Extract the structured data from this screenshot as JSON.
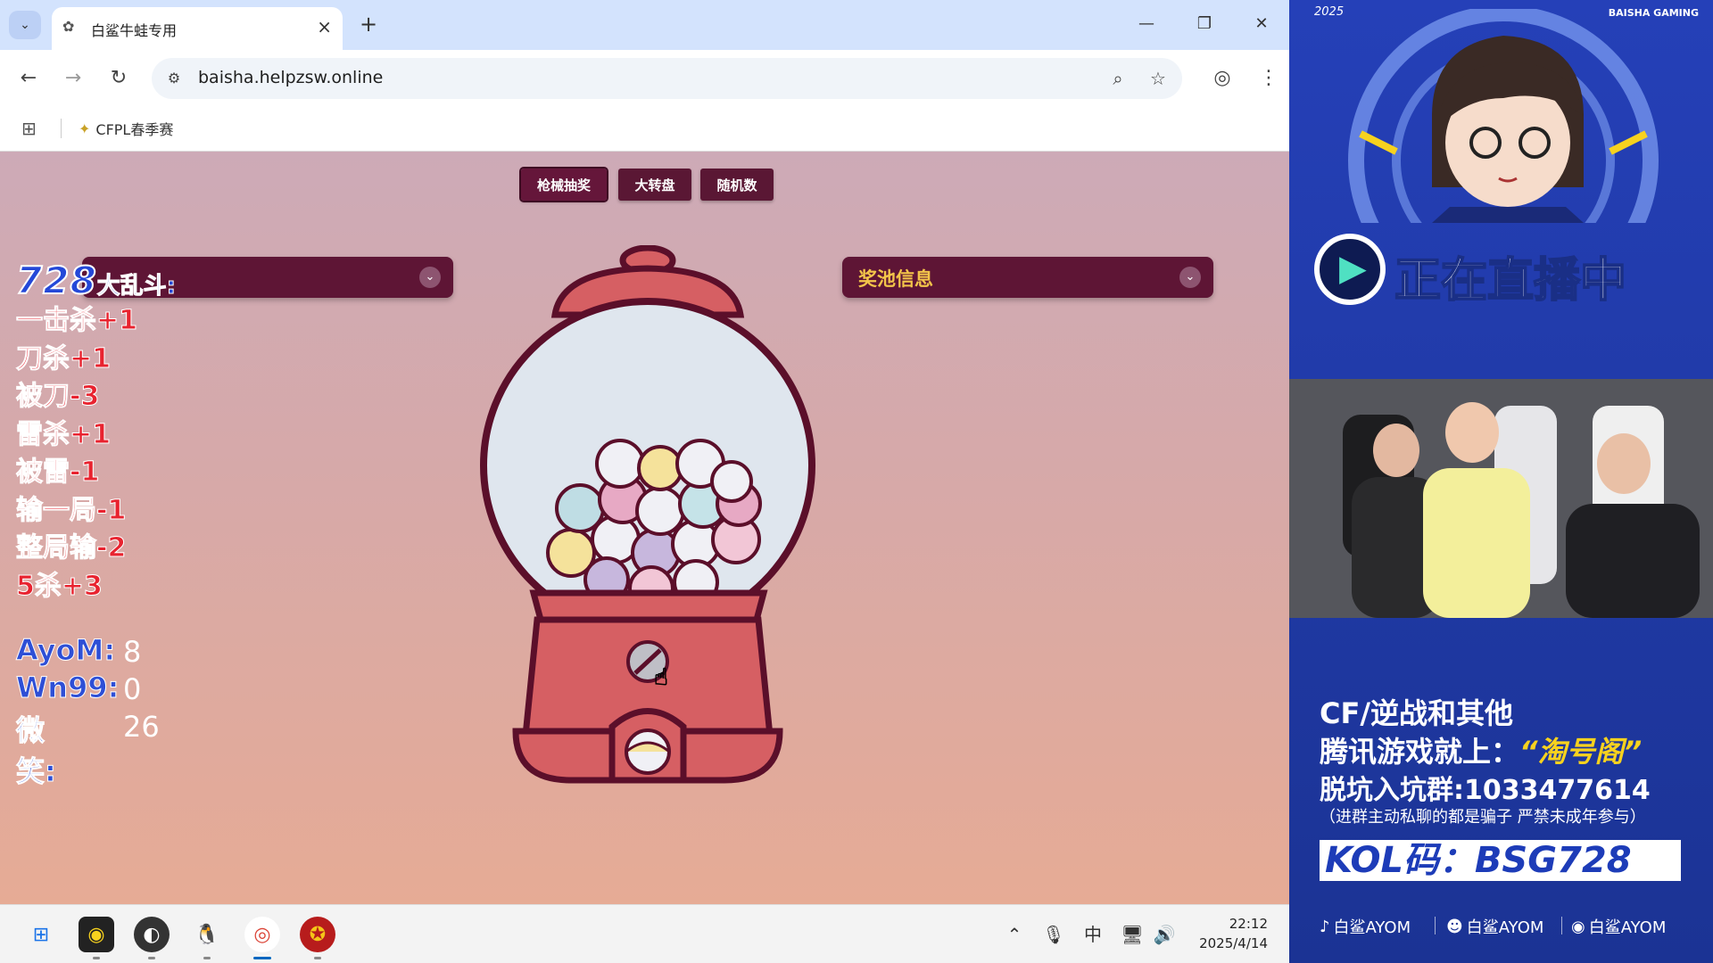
{
  "browser": {
    "tab_title": "白鲨牛蛙专用",
    "url": "baisha.helpzsw.online",
    "bookmark": "CFPL春季赛"
  },
  "page": {
    "buttons": [
      "枪械抽奖",
      "大转盘",
      "随机数"
    ],
    "active_button": "枪械抽奖",
    "right_panel_title": "奖池信息"
  },
  "overlay": {
    "title": "728",
    "subtitle": "大乱斗:",
    "rules": [
      "一击杀+1",
      "刀杀+1",
      "被刀-3",
      "雷杀+1",
      "被雷-1",
      "输一局-1",
      "整局输-2",
      "5杀+3"
    ],
    "scores": [
      {
        "name": "AyoM:",
        "value": "8"
      },
      {
        "name": "Wn99:",
        "value": "0"
      },
      {
        "name": "微笑:",
        "value": "26"
      }
    ]
  },
  "taskbar": {
    "ime": "中",
    "time": "22:12",
    "date": "2025/4/14"
  },
  "stream": {
    "year": "2025",
    "brand": "BAISHA GAMING",
    "live_text": "正在直播中",
    "ad_line1": "CF/逆战和其他",
    "ad_line2a": "腾讯游戏就上：",
    "ad_line2b": "“淘号阁”",
    "ad_line3": "脱坑入坑群:1033477614",
    "ad_line4": "（进群主动私聊的都是骗子 严禁未成年参与）",
    "kol": "KOL码：BSG728",
    "socials": [
      "白鲨AYOM",
      "白鲨AYOM",
      "白鲨AYOM"
    ]
  },
  "colors": {
    "page_button": "#5a1734",
    "panel_title": "#f3c54a",
    "stream_bg": "#2540b8"
  }
}
